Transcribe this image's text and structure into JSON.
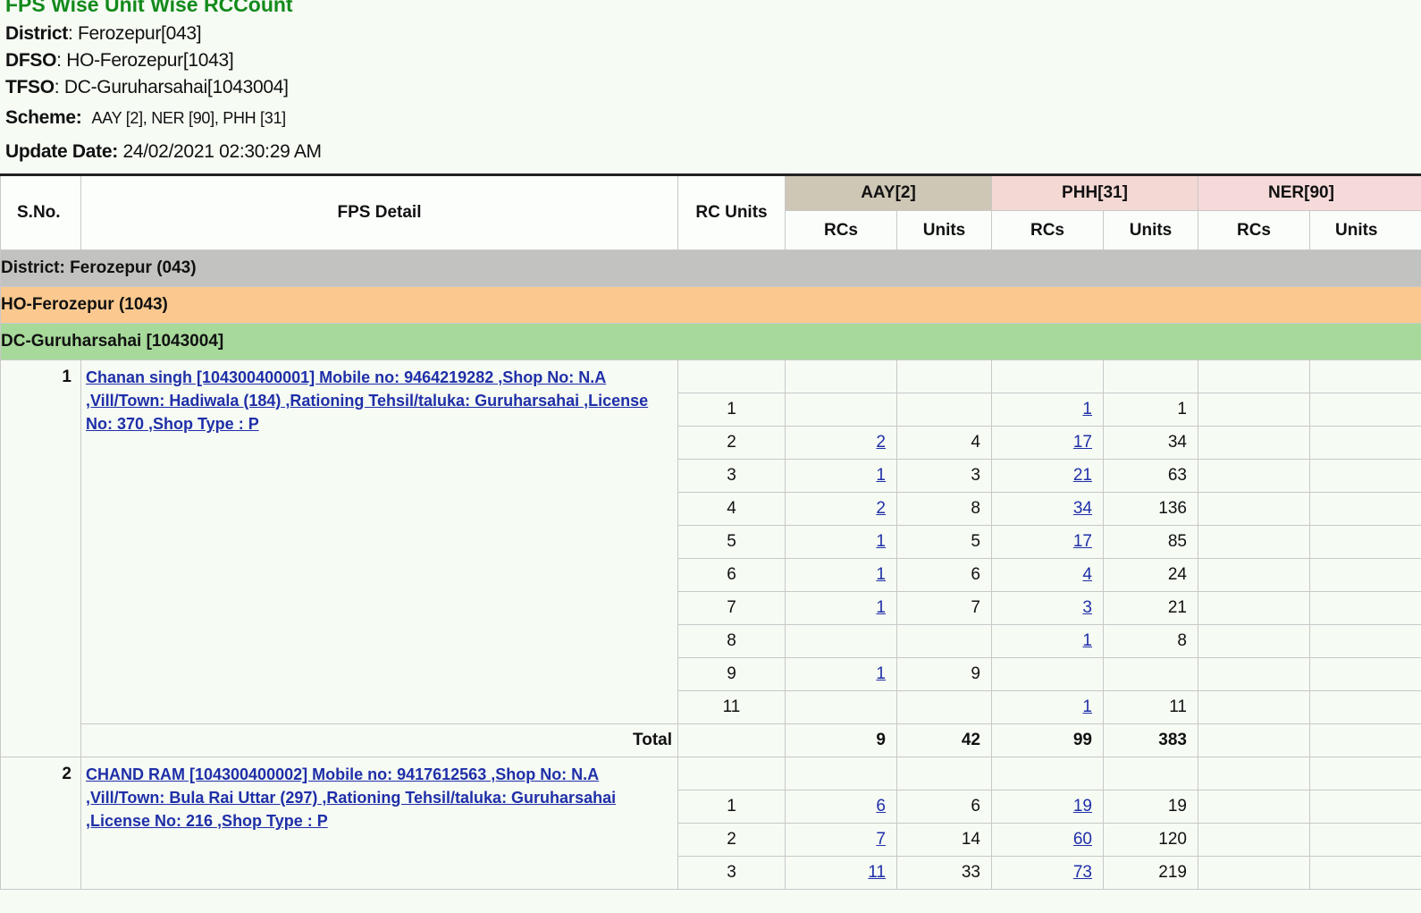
{
  "header": {
    "title": "FPS Wise Unit Wise RCCount",
    "district_label": "District",
    "district_value": ": Ferozepur[043]",
    "dfso_label": "DFSO",
    "dfso_value": ":  HO-Ferozepur[1043]",
    "tfso_label": "TFSO",
    "tfso_value": ": DC-Guruharsahai[1043004]",
    "scheme_label": "Scheme:",
    "scheme_value": "AAY [2], NER [90], PHH [31]",
    "update_label": "Update Date:",
    "update_value": "24/02/2021 02:30:29 AM"
  },
  "table": {
    "col_sno": "S.No.",
    "col_fps": "FPS Detail",
    "col_rcunits": "RC Units",
    "group_aay": "AAY[2]",
    "group_phh": "PHH[31]",
    "group_ner": "NER[90]",
    "sub_rcs": "RCs",
    "sub_units": "Units",
    "band_district_label": "District: ",
    "band_district_value": "Ferozepur (043)",
    "band_dfso": "HO-Ferozepur (1043)",
    "band_tfso": "DC-Guruharsahai [1043004]",
    "total_label": "Total"
  },
  "shops": [
    {
      "sno": "1",
      "detail": "Chanan singh [104300400001] Mobile no: 9464219282 ,Shop No: N.A ,Vill/Town: Hadiwala (184) ,Rationing Tehsil/taluka: Guruharsahai ,License No: 370 ,Shop Type : P",
      "rows": [
        {
          "units": "1",
          "aay_rcs": "",
          "aay_units": "",
          "phh_rcs": "1",
          "phh_units": "1"
        },
        {
          "units": "2",
          "aay_rcs": "2",
          "aay_units": "4",
          "phh_rcs": "17",
          "phh_units": "34"
        },
        {
          "units": "3",
          "aay_rcs": "1",
          "aay_units": "3",
          "phh_rcs": "21",
          "phh_units": "63"
        },
        {
          "units": "4",
          "aay_rcs": "2",
          "aay_units": "8",
          "phh_rcs": "34",
          "phh_units": "136"
        },
        {
          "units": "5",
          "aay_rcs": "1",
          "aay_units": "5",
          "phh_rcs": "17",
          "phh_units": "85"
        },
        {
          "units": "6",
          "aay_rcs": "1",
          "aay_units": "6",
          "phh_rcs": "4",
          "phh_units": "24"
        },
        {
          "units": "7",
          "aay_rcs": "1",
          "aay_units": "7",
          "phh_rcs": "3",
          "phh_units": "21"
        },
        {
          "units": "8",
          "aay_rcs": "",
          "aay_units": "",
          "phh_rcs": "1",
          "phh_units": "8"
        },
        {
          "units": "9",
          "aay_rcs": "1",
          "aay_units": "9",
          "phh_rcs": "",
          "phh_units": ""
        },
        {
          "units": "11",
          "aay_rcs": "",
          "aay_units": "",
          "phh_rcs": "1",
          "phh_units": "11"
        }
      ],
      "total": {
        "aay_rcs": "9",
        "aay_units": "42",
        "phh_rcs": "99",
        "phh_units": "383"
      }
    },
    {
      "sno": "2",
      "detail": "CHAND RAM [104300400002] Mobile no: 9417612563 ,Shop No: N.A ,Vill/Town: Bula Rai Uttar (297) ,Rationing Tehsil/taluka: Guruharsahai ,License No: 216 ,Shop Type : P",
      "rows": [
        {
          "units": "1",
          "aay_rcs": "6",
          "aay_units": "6",
          "phh_rcs": "19",
          "phh_units": "19"
        },
        {
          "units": "2",
          "aay_rcs": "7",
          "aay_units": "14",
          "phh_rcs": "60",
          "phh_units": "120"
        },
        {
          "units": "3",
          "aay_rcs": "11",
          "aay_units": "33",
          "phh_rcs": "73",
          "phh_units": "219"
        }
      ]
    }
  ]
}
